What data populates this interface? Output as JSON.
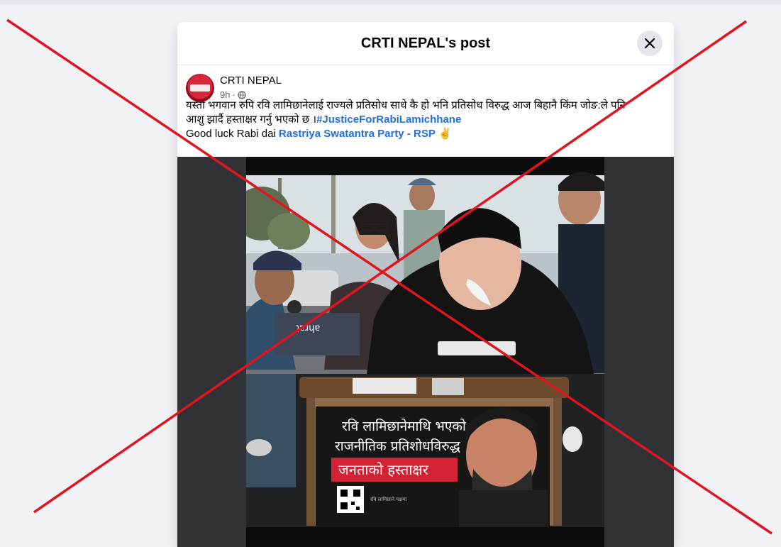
{
  "modal": {
    "title": "CRTI NEPAL's post",
    "close_label": "Close"
  },
  "post": {
    "author": "CRTI NEPAL",
    "time": "9h",
    "time_separator": "·",
    "text_line1": "यस्तो भगवान रुपि रवि लामिछानेलाई  राज्यले प्रतिसोध साधे कै हो भनि प्रतिसोध विरुद्ध  आज बिहानै किंम जोङ:ले पनि",
    "text_line2": "आशु झार्दै हस्ताक्षर गर्नु भएको छ ।",
    "hashtag": "#JusticeForRabiLamichhane",
    "text_line3": "Good luck Rabi dai ",
    "mention": "Rastriya Swatantra Party - RSP",
    "emoji": "✌️"
  },
  "photo": {
    "banner_line1": "रवि लामिछानेमाथि भएको",
    "banner_line2": "राजनीतिक प्रतिशोधविरुद्ध",
    "banner_line3": "जनताको हस्ताक्षर",
    "banner_small": "रवि लामिछाने पक्षमा"
  },
  "icons": {
    "close": "close-icon",
    "audience": "globe-icon"
  },
  "colors": {
    "link": "#216fdb",
    "cross": "#e0141e",
    "page_bg": "#f0f2f5"
  }
}
